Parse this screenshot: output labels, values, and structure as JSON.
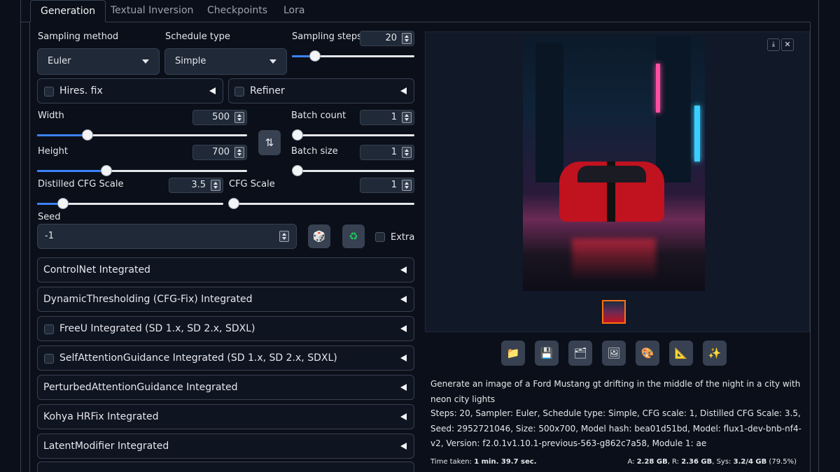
{
  "tabs": [
    "Generation",
    "Textual Inversion",
    "Checkpoints",
    "Lora"
  ],
  "sampling": {
    "method_label": "Sampling method",
    "method_value": "Euler",
    "schedule_label": "Schedule type",
    "schedule_value": "Simple",
    "steps_label": "Sampling steps",
    "steps_value": "20"
  },
  "hires_label": "Hires. fix",
  "refiner_label": "Refiner",
  "width": {
    "label": "Width",
    "value": "500"
  },
  "height": {
    "label": "Height",
    "value": "700"
  },
  "batch_count": {
    "label": "Batch count",
    "value": "1"
  },
  "batch_size": {
    "label": "Batch size",
    "value": "1"
  },
  "distilled_cfg": {
    "label": "Distilled CFG Scale",
    "value": "3.5"
  },
  "cfg": {
    "label": "CFG Scale",
    "value": "1"
  },
  "seed": {
    "label": "Seed",
    "value": "-1",
    "extra_label": "Extra"
  },
  "accordions": [
    {
      "label": "ControlNet Integrated",
      "checkbox": false
    },
    {
      "label": "DynamicThresholding (CFG-Fix) Integrated",
      "checkbox": false
    },
    {
      "label": "FreeU Integrated (SD 1.x, SD 2.x, SDXL)",
      "checkbox": true
    },
    {
      "label": "SelfAttentionGuidance Integrated (SD 1.x, SD 2.x, SDXL)",
      "checkbox": true
    },
    {
      "label": "PerturbedAttentionGuidance Integrated",
      "checkbox": false
    },
    {
      "label": "Kohya HRFix Integrated",
      "checkbox": false
    },
    {
      "label": "LatentModifier Integrated",
      "checkbox": false
    }
  ],
  "toolbar_icons": [
    "folder-icon",
    "save-icon",
    "zip-icon",
    "image-icon",
    "palette-icon",
    "ruler-icon",
    "sparkle-icon"
  ],
  "output": {
    "prompt": "Generate an image of a Ford Mustang gt drifting in the middle of the night in a city with neon city lights",
    "params": "Steps: 20, Sampler: Euler, Schedule type: Simple, CFG scale: 1, Distilled CFG Scale: 3.5, Seed: 2952721046, Size: 500x700, Model hash: bea01d51bd, Model: flux1-dev-bnb-nf4-v2, Version: f2.0.1v1.10.1-previous-563-g862c7a58, Module 1: ae",
    "time_label": "Time taken: ",
    "time_value": "1 min. 39.7 sec.",
    "mem_a_label": "A: ",
    "mem_a": "2.28 GB",
    "mem_r_label": ", R: ",
    "mem_r": "2.36 GB",
    "mem_sys_label": ", Sys: ",
    "mem_sys": "3.2/4 GB",
    "mem_pct": " (79.5%)"
  },
  "sliders": {
    "steps": 0.19,
    "width": 0.24,
    "height": 0.33,
    "batch_count": 0.0,
    "batch_size": 0.0,
    "distilled_cfg": 0.14,
    "cfg": 0.03
  },
  "colors": {
    "accent": "#3b82f6",
    "background": "#0b0f19",
    "thumb_border": "#f97316"
  }
}
